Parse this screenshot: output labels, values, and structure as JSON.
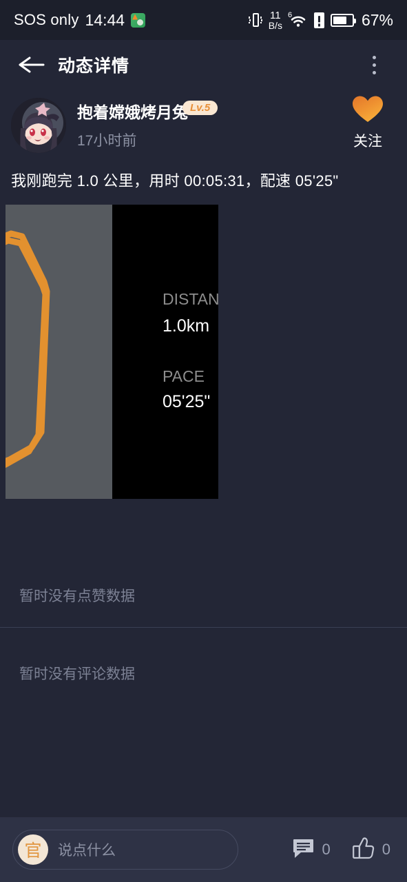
{
  "status_bar": {
    "carrier": "SOS only",
    "time": "14:44",
    "app_icon": "notepad-icon",
    "vibrate_icon": "vibrate-icon",
    "net_speed_value": "11",
    "net_speed_unit": "B/s",
    "wifi_icon": "wifi-icon",
    "wifi_generation": "6",
    "sim_icon": "sim-alert-icon",
    "battery_icon": "battery-icon",
    "battery_percent": "67%"
  },
  "header": {
    "back_icon": "back-arrow-icon",
    "title": "动态详情",
    "more_icon": "more-vertical-icon"
  },
  "author": {
    "avatar": "user-avatar",
    "name": "抱着嫦娥烤月兔",
    "level_badge": "Lv.5",
    "time_ago": "17小时前",
    "follow_icon": "heart-icon",
    "follow_label": "关注",
    "accent_color": "#ef8d2e"
  },
  "post": {
    "text": "我刚跑完 1.0 公里，用时 00:05:31，配速 05'25\"",
    "media": {
      "map_icon": "route-map",
      "route_color": "#e3912f",
      "map_background": "#565a5f",
      "stats_background": "#000000",
      "stats": [
        {
          "label": "DISTANCE",
          "value": "1.0km"
        },
        {
          "label": "PACE",
          "value": "05'25\""
        }
      ]
    }
  },
  "likes_section": {
    "empty_text": "暂时没有点赞数据"
  },
  "comments_section": {
    "empty_text": "暂时没有评论数据"
  },
  "bottom_bar": {
    "avatar_char": "官",
    "input_placeholder": "说点什么",
    "comment_icon": "comment-icon",
    "comment_count": "0",
    "like_icon": "thumbs-up-icon",
    "like_count": "0"
  }
}
